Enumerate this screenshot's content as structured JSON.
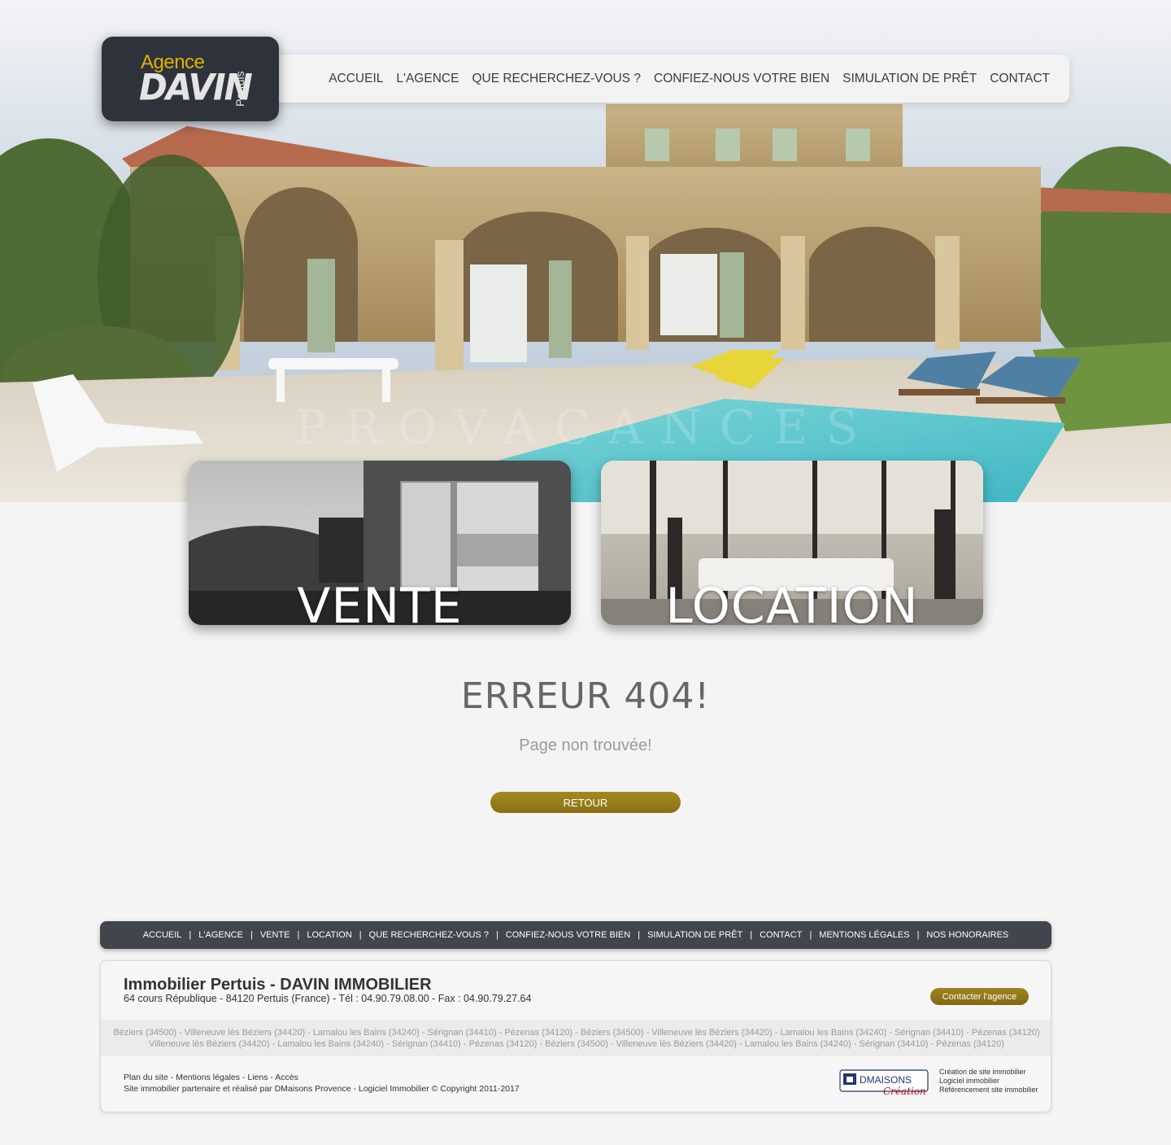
{
  "logo": {
    "top": "Agence",
    "main": "DAVIN",
    "side": "Pertuis"
  },
  "nav": {
    "items": [
      "ACCUEIL",
      "L'AGENCE",
      "QUE RECHERCHEZ-VOUS ?",
      "CONFIEZ-NOUS VOTRE BIEN",
      "SIMULATION DE PRÊT",
      "CONTACT"
    ]
  },
  "cards": {
    "vente": "VENTE",
    "location": "LOCATION"
  },
  "error": {
    "title": "ERREUR 404!",
    "subtitle": "Page non trouvée!",
    "button": "RETOUR"
  },
  "footer_nav": {
    "items": [
      "ACCUEIL",
      "L'AGENCE",
      "VENTE",
      "LOCATION",
      "QUE RECHERCHEZ-VOUS ?",
      "CONFIEZ-NOUS VOTRE BIEN",
      "SIMULATION DE PRÊT",
      "CONTACT",
      "MENTIONS LÉGALES",
      "NOS HONORAIRES"
    ]
  },
  "footer": {
    "agency_name": "Immobilier Pertuis - DAVIN IMMOBILIER",
    "address": "64 cours République - 84120 Pertuis (France) - Tél : 04.90.79.08.00 - Fax : 04.90.79.27.64",
    "contact_button": "Contacter l'agence",
    "cities_line1": "Béziers (34500) - Villeneuve lès Béziers (34420) - Lamalou les Bains (34240) - Sérignan (34410) - Pézenas (34120) - Béziers (34500) - Villeneuve lès Béziers (34420) - Lamalou les Bains (34240) - Sérignan (34410) - Pézenas (34120)",
    "cities_line2": "Villeneuve lès Béziers (34420) - Lamalou les Bains (34240) - Sérignan (34410) - Pézenas (34120) - Béziers (34500) - Villeneuve lès Béziers (34420) - Lamalou les Bains (34240) - Sérignan (34410) - Pézenas (34120)",
    "links": {
      "plan": "Plan du site",
      "mentions": "Mentions légales",
      "liens": "Liens",
      "acces": "Accès",
      "sep": " - "
    },
    "partner": "Site immobilier partenaire et réalisé par DMaisons Provence - Logiciel Immobilier © Copyright 2011-2017",
    "dmaisons": {
      "brand": "DMAISONS",
      "script": "Création"
    },
    "dm_lines": [
      "Création de site immobilier",
      "Logiciel immobilier",
      "Référencement site immobilier"
    ]
  },
  "watermark": "PROVACANCES",
  "colors": {
    "gold": "#95781a",
    "dark": "#41464d",
    "logo_bg": "#2e333b",
    "logo_yellow": "#e1b100"
  }
}
